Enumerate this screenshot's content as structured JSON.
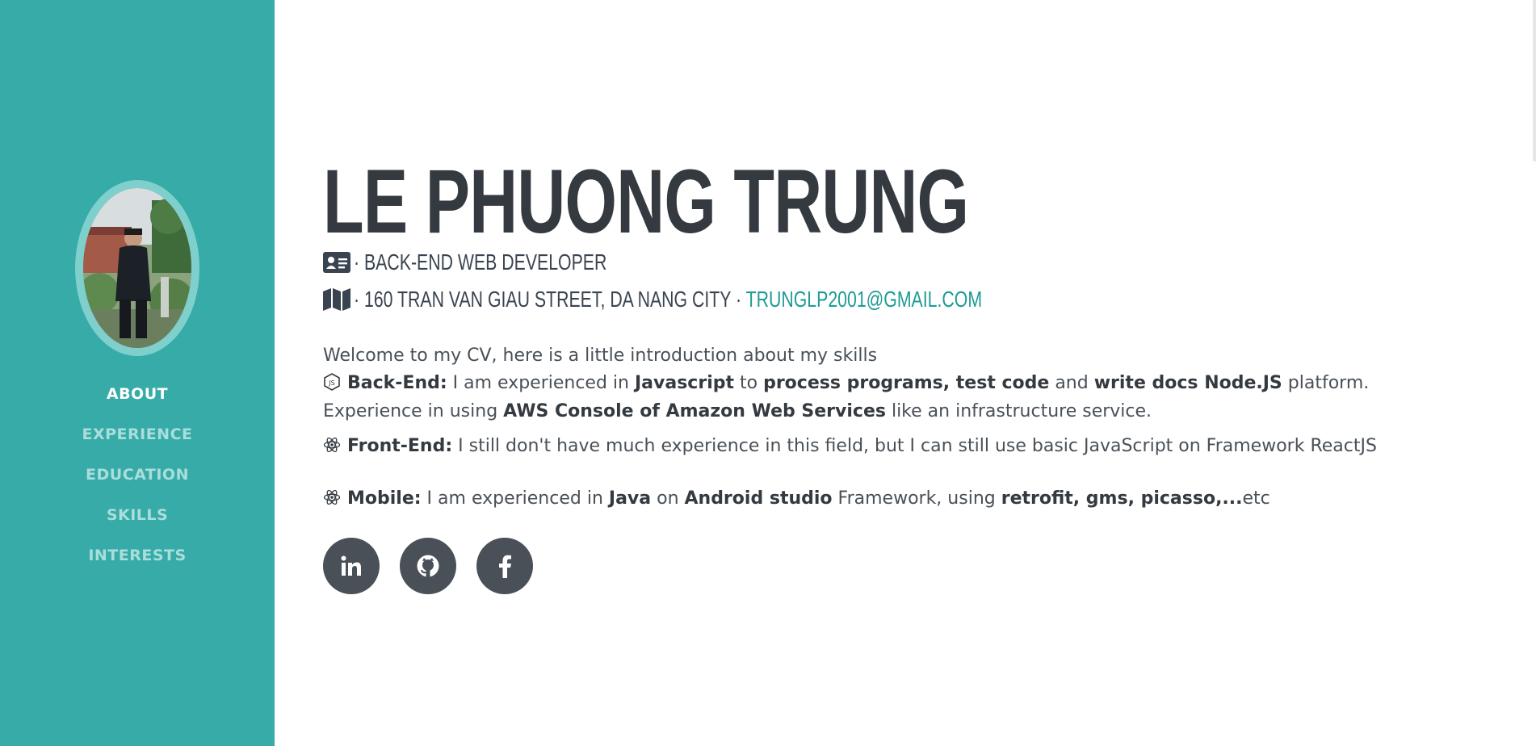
{
  "profile": {
    "name": "LE PHUONG TRUNG",
    "role": "BACK-END WEB DEVELOPER",
    "separator": "·",
    "address": "160 TRAN VAN GIAU STREET, DA NANG CITY",
    "email": "TRUNGLP2001@GMAIL.COM"
  },
  "nav": {
    "items": [
      {
        "label": "ABOUT",
        "active": true
      },
      {
        "label": "EXPERIENCE"
      },
      {
        "label": "EDUCATION"
      },
      {
        "label": "SKILLS"
      },
      {
        "label": "INTERESTS"
      }
    ]
  },
  "about": {
    "welcome": "Welcome to my CV, here is a little introduction about my skills",
    "backend": {
      "title": "Back-End:",
      "t1": " I am experienced in ",
      "b1": "Javascript",
      "t2": " to ",
      "b2": "process programs, test code",
      "t3": " and ",
      "b3": "write docs Node.JS",
      "t4": " platform. Experience in using ",
      "b4": "AWS Console of Amazon Web Services",
      "t5": " like an infrastructure service."
    },
    "frontend": {
      "title": "Front-End:",
      "text": " I still don't have much experience in this field, but I can still use basic JavaScript on Framework ReactJS"
    },
    "mobile": {
      "title": "Mobile:",
      "t1": " I am experienced in ",
      "b1": "Java",
      "t2": " on ",
      "b2": "Android studio",
      "t3": " Framework, using ",
      "b3": "retrofit, gms, picasso,...",
      "t4": "etc"
    }
  },
  "social": [
    {
      "icon": "linkedin-icon"
    },
    {
      "icon": "github-icon"
    },
    {
      "icon": "facebook-icon"
    }
  ],
  "colors": {
    "sidebar": "#37aba8",
    "accent": "#1e9c95",
    "heading": "#343a40",
    "social_bg": "#495057"
  }
}
